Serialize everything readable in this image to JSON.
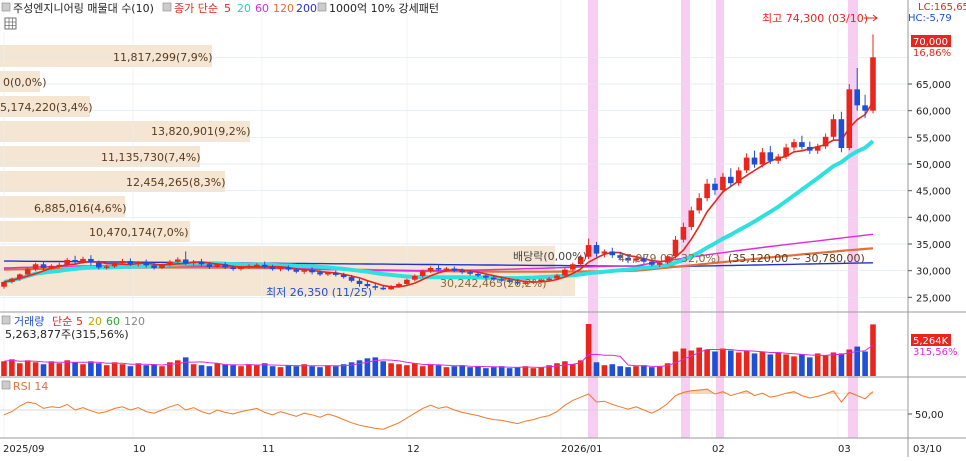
{
  "header": {
    "title": "주성엔지니어링 매물대 수(10)",
    "close_label": "종가 단순",
    "ma_periods": [
      "5",
      "20",
      "60",
      "120",
      "200"
    ],
    "pattern_label": "1000억 10% 강세패턴"
  },
  "volume_header": {
    "label": "거래량",
    "ma_label": "단순",
    "ma_periods": [
      "5",
      "20",
      "60",
      "120"
    ],
    "value_text": "5,263,877주(315,56%)"
  },
  "rsi_header": {
    "label": "RSI 14"
  },
  "price_axis": {
    "ticks": [
      "70,000",
      "65,000",
      "60,000",
      "55,000",
      "50,000",
      "45,000",
      "40,000",
      "35,000",
      "30,000",
      "25,000"
    ],
    "lc_text": "LC:165,65",
    "hc_text": "HC:-5,79",
    "current_price": "70,000",
    "current_change": "16,86%"
  },
  "volume_axis": {
    "current_value": "5,264K",
    "current_ratio": "315,56%"
  },
  "rsi_axis": {
    "ticks": [
      "50,00"
    ]
  },
  "date_axis": {
    "labels": [
      "2025/09",
      "10",
      "11",
      "12",
      "2026/01",
      "02",
      "03",
      "03/10"
    ]
  },
  "annotations": {
    "high": "최고 74,300 (03/10)",
    "low": "최저 26,350 (11/25)",
    "dividend": "배당락(0,00%)",
    "label_b": "30,242,465(20,2%)",
    "label_c": "47,979,03",
    "label_d": "32,0%)",
    "label_e": "(35,120,00 ~ 30,780,00)"
  },
  "colors": {
    "up": "#e8261d",
    "down": "#1f4fd6",
    "ma5": "#e8261d",
    "ma20": "#2fe0e0",
    "ma60": "#dd2bdd",
    "ma120": "#e0703a",
    "ma200": "#2233cc",
    "volume_profile": "#f5e6d3",
    "highlight": "#f7c4f0",
    "rsi": "#f07a2a"
  },
  "chart_data": {
    "type": "candlestick",
    "title": "주성엔지니어링",
    "x_range": [
      "2025-09",
      "2026-03-10"
    ],
    "ylim": [
      23000,
      77000
    ],
    "y_ticks": [
      25000,
      30000,
      35000,
      40000,
      45000,
      50000,
      55000,
      60000,
      65000,
      70000
    ],
    "candles": [
      {
        "o": 27000,
        "h": 28000,
        "c": 27900,
        "l": 26600
      },
      {
        "o": 27900,
        "h": 28700,
        "c": 28500,
        "l": 27600
      },
      {
        "o": 28500,
        "h": 29500,
        "c": 29300,
        "l": 28100
      },
      {
        "o": 29300,
        "h": 30600,
        "c": 30300,
        "l": 29000
      },
      {
        "o": 30300,
        "h": 31500,
        "c": 31200,
        "l": 29900
      },
      {
        "o": 31200,
        "h": 31800,
        "c": 30500,
        "l": 30100
      },
      {
        "o": 30500,
        "h": 31200,
        "c": 30900,
        "l": 30200
      },
      {
        "o": 30900,
        "h": 31500,
        "c": 31100,
        "l": 30600
      },
      {
        "o": 31100,
        "h": 32400,
        "c": 32000,
        "l": 30800
      },
      {
        "o": 32000,
        "h": 32800,
        "c": 31600,
        "l": 31200
      },
      {
        "o": 31600,
        "h": 32600,
        "c": 32200,
        "l": 31300
      },
      {
        "o": 32200,
        "h": 32900,
        "c": 31500,
        "l": 31000
      },
      {
        "o": 31500,
        "h": 31900,
        "c": 30600,
        "l": 30200
      },
      {
        "o": 30600,
        "h": 31100,
        "c": 30800,
        "l": 30200
      },
      {
        "o": 30800,
        "h": 31700,
        "c": 31400,
        "l": 30500
      },
      {
        "o": 31400,
        "h": 32200,
        "c": 31800,
        "l": 31100
      },
      {
        "o": 31800,
        "h": 32300,
        "c": 31200,
        "l": 30900
      },
      {
        "o": 31200,
        "h": 31800,
        "c": 31600,
        "l": 30800
      },
      {
        "o": 31600,
        "h": 32100,
        "c": 31000,
        "l": 30600
      },
      {
        "o": 31000,
        "h": 31500,
        "c": 30500,
        "l": 30200
      },
      {
        "o": 30500,
        "h": 31300,
        "c": 31100,
        "l": 30300
      },
      {
        "o": 31100,
        "h": 32000,
        "c": 31700,
        "l": 30800
      },
      {
        "o": 31700,
        "h": 32500,
        "c": 32100,
        "l": 31400
      },
      {
        "o": 32100,
        "h": 33600,
        "c": 31400,
        "l": 31100
      },
      {
        "o": 31400,
        "h": 32000,
        "c": 31700,
        "l": 31000
      },
      {
        "o": 31700,
        "h": 32200,
        "c": 31200,
        "l": 30900
      },
      {
        "o": 31200,
        "h": 31600,
        "c": 30700,
        "l": 30300
      },
      {
        "o": 30700,
        "h": 31400,
        "c": 31200,
        "l": 30500
      },
      {
        "o": 31200,
        "h": 31600,
        "c": 30600,
        "l": 30300
      },
      {
        "o": 30600,
        "h": 31000,
        "c": 30300,
        "l": 30000
      },
      {
        "o": 30300,
        "h": 30900,
        "c": 30700,
        "l": 30000
      },
      {
        "o": 30700,
        "h": 31200,
        "c": 30900,
        "l": 30400
      },
      {
        "o": 30900,
        "h": 31400,
        "c": 31100,
        "l": 30600
      },
      {
        "o": 31100,
        "h": 31700,
        "c": 30700,
        "l": 30400
      },
      {
        "o": 30700,
        "h": 31100,
        "c": 30300,
        "l": 30000
      },
      {
        "o": 30300,
        "h": 30800,
        "c": 30600,
        "l": 29900
      },
      {
        "o": 30600,
        "h": 31000,
        "c": 30200,
        "l": 29900
      },
      {
        "o": 30200,
        "h": 30500,
        "c": 29800,
        "l": 29500
      },
      {
        "o": 29800,
        "h": 30300,
        "c": 30100,
        "l": 29400
      },
      {
        "o": 30100,
        "h": 30600,
        "c": 29700,
        "l": 29300
      },
      {
        "o": 29700,
        "h": 30100,
        "c": 29300,
        "l": 29000
      },
      {
        "o": 29300,
        "h": 29800,
        "c": 29600,
        "l": 29000
      },
      {
        "o": 29600,
        "h": 30000,
        "c": 29200,
        "l": 28900
      },
      {
        "o": 29200,
        "h": 29600,
        "c": 28800,
        "l": 28500
      },
      {
        "o": 28800,
        "h": 29200,
        "c": 28100,
        "l": 27800
      },
      {
        "o": 28100,
        "h": 28500,
        "c": 27500,
        "l": 27000
      },
      {
        "o": 27500,
        "h": 28000,
        "c": 27100,
        "l": 26700
      },
      {
        "o": 27100,
        "h": 27600,
        "c": 26800,
        "l": 26350
      },
      {
        "o": 26800,
        "h": 27200,
        "c": 26500,
        "l": 26350
      },
      {
        "o": 26500,
        "h": 27300,
        "c": 27000,
        "l": 26400
      },
      {
        "o": 27000,
        "h": 27800,
        "c": 27500,
        "l": 26800
      },
      {
        "o": 27500,
        "h": 28500,
        "c": 28300,
        "l": 27300
      },
      {
        "o": 28300,
        "h": 29300,
        "c": 29000,
        "l": 28000
      },
      {
        "o": 29000,
        "h": 30200,
        "c": 29900,
        "l": 28700
      },
      {
        "o": 29900,
        "h": 30800,
        "c": 30500,
        "l": 29600
      },
      {
        "o": 30500,
        "h": 31000,
        "c": 30200,
        "l": 29900
      },
      {
        "o": 30200,
        "h": 30700,
        "c": 30400,
        "l": 29800
      },
      {
        "o": 30400,
        "h": 30800,
        "c": 30000,
        "l": 29700
      },
      {
        "o": 30000,
        "h": 30400,
        "c": 29700,
        "l": 29400
      },
      {
        "o": 29700,
        "h": 30100,
        "c": 29400,
        "l": 29100
      },
      {
        "o": 29400,
        "h": 29800,
        "c": 29100,
        "l": 28800
      },
      {
        "o": 29100,
        "h": 29400,
        "c": 28700,
        "l": 28400
      },
      {
        "o": 28700,
        "h": 29100,
        "c": 28400,
        "l": 28100
      },
      {
        "o": 28400,
        "h": 28800,
        "c": 28200,
        "l": 27900
      },
      {
        "o": 28200,
        "h": 28600,
        "c": 27900,
        "l": 27600
      },
      {
        "o": 27900,
        "h": 28300,
        "c": 27600,
        "l": 27300
      },
      {
        "o": 27600,
        "h": 28000,
        "c": 27800,
        "l": 27300
      },
      {
        "o": 27800,
        "h": 28300,
        "c": 28000,
        "l": 27500
      },
      {
        "o": 28000,
        "h": 28500,
        "c": 28300,
        "l": 27700
      },
      {
        "o": 28300,
        "h": 28800,
        "c": 28500,
        "l": 28000
      },
      {
        "o": 28500,
        "h": 29400,
        "c": 29100,
        "l": 28200
      },
      {
        "o": 29100,
        "h": 30500,
        "c": 30200,
        "l": 28900
      },
      {
        "o": 30200,
        "h": 31500,
        "c": 31200,
        "l": 29900
      },
      {
        "o": 31200,
        "h": 33000,
        "c": 32600,
        "l": 30900
      },
      {
        "o": 32600,
        "h": 36000,
        "c": 34800,
        "l": 32200
      },
      {
        "o": 34800,
        "h": 35400,
        "c": 33200,
        "l": 32600
      },
      {
        "o": 33200,
        "h": 34000,
        "c": 33600,
        "l": 32500
      },
      {
        "o": 33600,
        "h": 34300,
        "c": 32900,
        "l": 32400
      },
      {
        "o": 32900,
        "h": 33500,
        "c": 32400,
        "l": 31900
      },
      {
        "o": 32400,
        "h": 32900,
        "c": 31900,
        "l": 31400
      },
      {
        "o": 31900,
        "h": 32600,
        "c": 32300,
        "l": 31500
      },
      {
        "o": 32300,
        "h": 33000,
        "c": 31700,
        "l": 31300
      },
      {
        "o": 31700,
        "h": 32300,
        "c": 31100,
        "l": 30800
      },
      {
        "o": 31100,
        "h": 31800,
        "c": 31500,
        "l": 30700
      },
      {
        "o": 31500,
        "h": 33000,
        "c": 32700,
        "l": 31200
      },
      {
        "o": 32700,
        "h": 36500,
        "c": 35800,
        "l": 32300
      },
      {
        "o": 35800,
        "h": 39000,
        "c": 38200,
        "l": 35300
      },
      {
        "o": 38200,
        "h": 42000,
        "c": 41300,
        "l": 37600
      },
      {
        "o": 41300,
        "h": 44500,
        "c": 43600,
        "l": 40700
      },
      {
        "o": 43600,
        "h": 47200,
        "c": 46300,
        "l": 43000
      },
      {
        "o": 46300,
        "h": 47400,
        "c": 45100,
        "l": 44200
      },
      {
        "o": 45100,
        "h": 48300,
        "c": 47600,
        "l": 44500
      },
      {
        "o": 47600,
        "h": 49200,
        "c": 46400,
        "l": 45700
      },
      {
        "o": 46400,
        "h": 49400,
        "c": 48800,
        "l": 45900
      },
      {
        "o": 48800,
        "h": 52000,
        "c": 51200,
        "l": 48300
      },
      {
        "o": 51200,
        "h": 52500,
        "c": 49900,
        "l": 49300
      },
      {
        "o": 49900,
        "h": 53000,
        "c": 52200,
        "l": 49400
      },
      {
        "o": 52200,
        "h": 53400,
        "c": 50600,
        "l": 50000
      },
      {
        "o": 50600,
        "h": 51900,
        "c": 51400,
        "l": 50000
      },
      {
        "o": 51400,
        "h": 53800,
        "c": 53100,
        "l": 50900
      },
      {
        "o": 53100,
        "h": 54700,
        "c": 54100,
        "l": 52500
      },
      {
        "o": 54100,
        "h": 55300,
        "c": 53200,
        "l": 52700
      },
      {
        "o": 53200,
        "h": 54200,
        "c": 52500,
        "l": 51900
      },
      {
        "o": 52500,
        "h": 53800,
        "c": 53300,
        "l": 51900
      },
      {
        "o": 53300,
        "h": 55700,
        "c": 55100,
        "l": 52800
      },
      {
        "o": 55100,
        "h": 59300,
        "c": 58400,
        "l": 54600
      },
      {
        "o": 58400,
        "h": 59800,
        "c": 53000,
        "l": 52200
      },
      {
        "o": 53000,
        "h": 65000,
        "c": 64000,
        "l": 52600
      },
      {
        "o": 64000,
        "h": 68000,
        "c": 61000,
        "l": 60000
      },
      {
        "o": 61000,
        "h": 63000,
        "c": 60000,
        "l": 58600
      },
      {
        "o": 60000,
        "h": 74300,
        "c": 70000,
        "l": 59500
      }
    ],
    "volume": [
      1.5,
      1.7,
      1.3,
      1.6,
      1.4,
      1.2,
      1.5,
      1.3,
      1.6,
      1.4,
      1.2,
      1.5,
      1.3,
      1.1,
      1.4,
      1.2,
      1.0,
      1.3,
      1.1,
      1.2,
      1.0,
      1.4,
      1.6,
      1.9,
      1.2,
      1.1,
      1.0,
      1.3,
      1.2,
      1.1,
      1.0,
      1.2,
      1.1,
      1.3,
      1.0,
      0.9,
      1.1,
      1.0,
      1.2,
      1.0,
      0.9,
      1.1,
      1.0,
      1.2,
      1.4,
      1.6,
      1.8,
      1.9,
      1.5,
      1.3,
      1.2,
      1.1,
      1.3,
      1.0,
      1.2,
      1.1,
      0.9,
      1.0,
      1.1,
      0.9,
      1.0,
      0.8,
      0.9,
      1.0,
      0.8,
      0.9,
      1.0,
      0.8,
      0.9,
      1.1,
      1.3,
      1.5,
      1.2,
      1.6,
      5.3,
      1.4,
      1.1,
      1.2,
      1.0,
      0.9,
      1.0,
      1.1,
      0.9,
      1.0,
      1.3,
      2.5,
      2.8,
      2.6,
      2.9,
      2.7,
      2.5,
      2.8,
      2.6,
      2.4,
      2.6,
      2.3,
      2.5,
      2.2,
      2.4,
      2.2,
      2.0,
      2.2,
      1.9,
      2.3,
      2.1,
      2.4,
      2.3,
      2.7,
      3.0,
      2.5,
      5.26
    ],
    "rsi": [
      44,
      48,
      55,
      60,
      58,
      52,
      54,
      53,
      57,
      50,
      53,
      49,
      46,
      48,
      52,
      54,
      50,
      53,
      48,
      46,
      50,
      54,
      57,
      50,
      53,
      48,
      45,
      50,
      47,
      45,
      48,
      50,
      52,
      47,
      44,
      48,
      45,
      42,
      46,
      44,
      41,
      45,
      42,
      38,
      34,
      31,
      29,
      27,
      26,
      30,
      34,
      40,
      46,
      52,
      56,
      52,
      54,
      50,
      47,
      45,
      43,
      40,
      38,
      37,
      35,
      33,
      36,
      38,
      41,
      43,
      48,
      56,
      62,
      66,
      70,
      60,
      61,
      57,
      54,
      51,
      54,
      50,
      46,
      51,
      58,
      68,
      72,
      74,
      75,
      76,
      70,
      73,
      68,
      71,
      74,
      68,
      71,
      66,
      68,
      71,
      73,
      68,
      65,
      67,
      70,
      74,
      60,
      72,
      68,
      64,
      73
    ],
    "ylabel": "",
    "xlabel": ""
  }
}
